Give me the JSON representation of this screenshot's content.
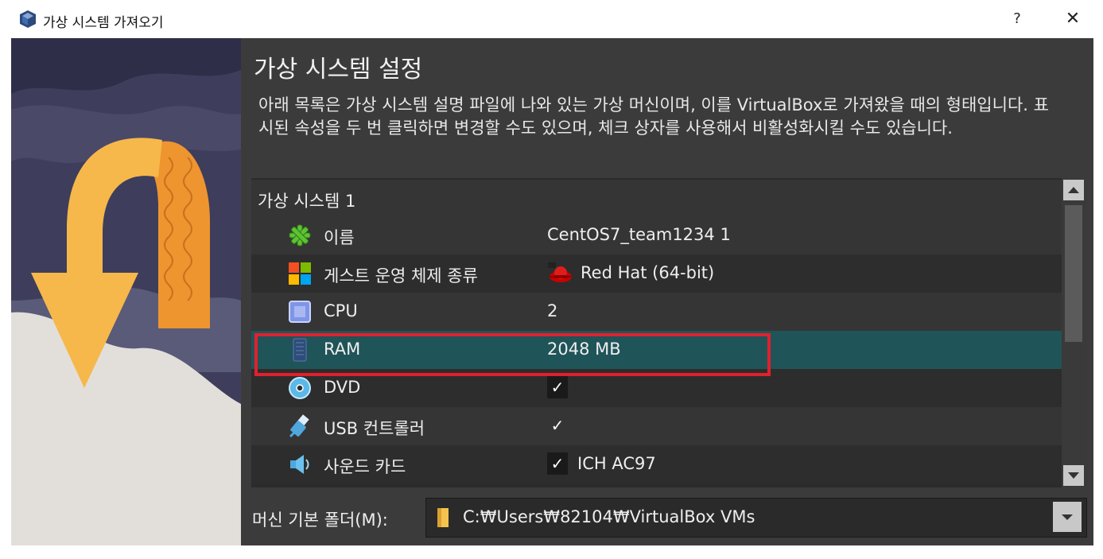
{
  "window": {
    "title": "가상 시스템 가져오기",
    "help_label": "?",
    "close_label": "✕"
  },
  "page": {
    "heading": "가상 시스템 설정",
    "description": "아래 목록은 가상 시스템 설명 파일에 나와 있는 가상 머신이며, 이를 VirtualBox로 가져왔을 때의 형태입니다. 표시된 속성을 두 번 클릭하면 변경할 수도 있으며, 체크 상자를 사용해서 비활성화시킬 수도 있습니다."
  },
  "tree": {
    "group_label": "가상 시스템 1",
    "rows": [
      {
        "label": "이름",
        "value": "CentOS7_team1234 1",
        "icon": "name-star-icon"
      },
      {
        "label": "게스트 운영 체제 종류",
        "value": "Red Hat (64-bit)",
        "icon": "os-type-icon"
      },
      {
        "label": "CPU",
        "value": "2",
        "icon": "cpu-icon"
      },
      {
        "label": "RAM",
        "value": "2048 MB",
        "icon": "ram-icon",
        "selected": true
      },
      {
        "label": "DVD",
        "value": "✓",
        "icon": "dvd-icon"
      },
      {
        "label": "USB 컨트롤러",
        "value": "✓",
        "icon": "usb-icon"
      },
      {
        "label": "사운드 카드",
        "check": "✓",
        "value": "ICH AC97",
        "icon": "sound-icon"
      }
    ]
  },
  "folder": {
    "label": "머신 기본 폴더(M):",
    "path": "C:₩Users₩82104₩VirtualBox VMs"
  },
  "colors": {
    "panel_bg": "#3b3b3b",
    "selected_row": "#1f5458",
    "highlight_box": "#e1202e"
  }
}
